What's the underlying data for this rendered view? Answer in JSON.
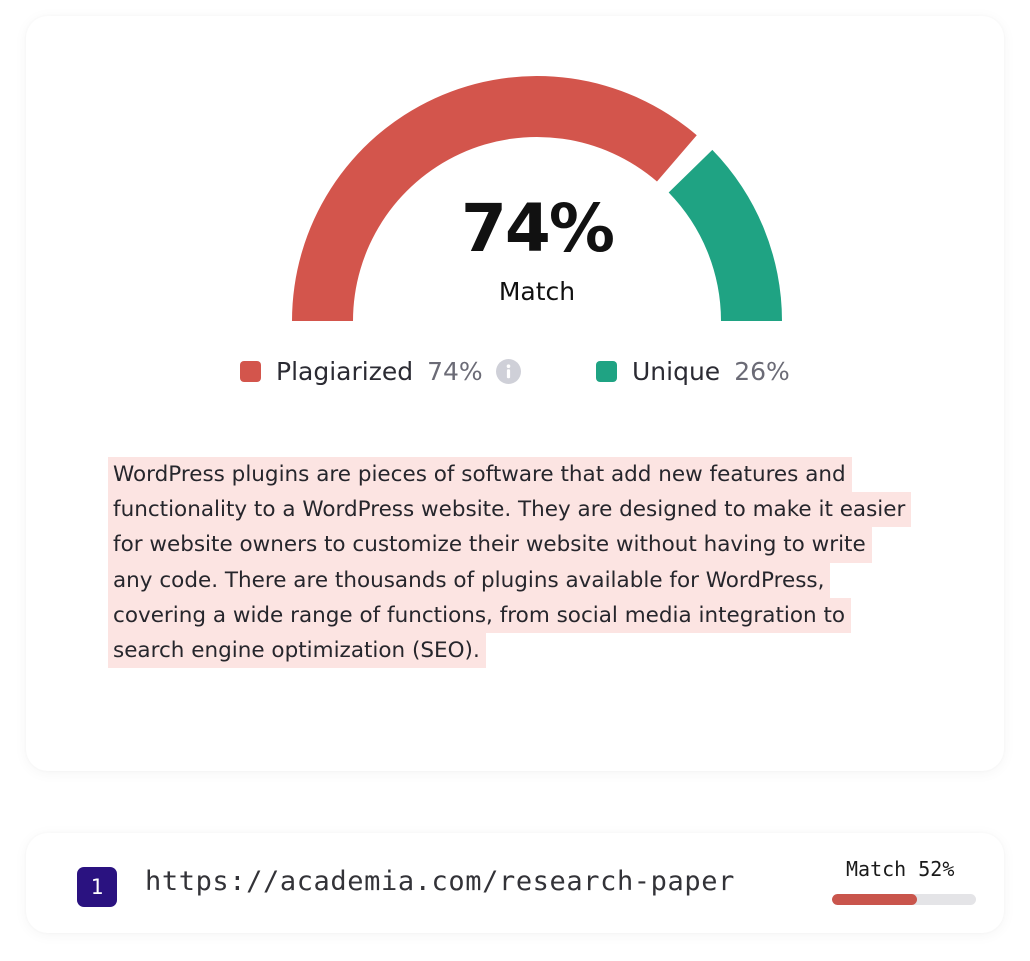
{
  "gauge": {
    "value_label": "74%",
    "caption": "Match",
    "plagiarized_fraction": 0.74,
    "unique_fraction": 0.26
  },
  "legend": {
    "plagiarized": {
      "label": "Plagiarized",
      "value": "74%"
    },
    "unique": {
      "label": "Unique",
      "value": "26%"
    }
  },
  "passage": {
    "lines": [
      "WordPress plugins are pieces of software that add new features and",
      "functionality to a WordPress website. They are designed to make it easier",
      "for website owners to customize their website without having to write",
      "any code. There are thousands of plugins available for WordPress,",
      "covering a wide range of functions, from social media integration to",
      "search engine optimization (SEO)."
    ]
  },
  "sources": [
    {
      "rank": "1",
      "url": "https://academia.com/research-paper",
      "match_label": "Match 52%",
      "match_fraction": 0.59
    }
  ],
  "icons": {
    "info": "info-icon"
  },
  "colors": {
    "plagiarized": "#d3554c",
    "unique": "#1fa383",
    "highlight": "#fce4e2",
    "badge": "#2a1280",
    "match_track": "#e4e4e7",
    "match_fill": "#c9554c",
    "info_icon": "#cfd0d8"
  }
}
